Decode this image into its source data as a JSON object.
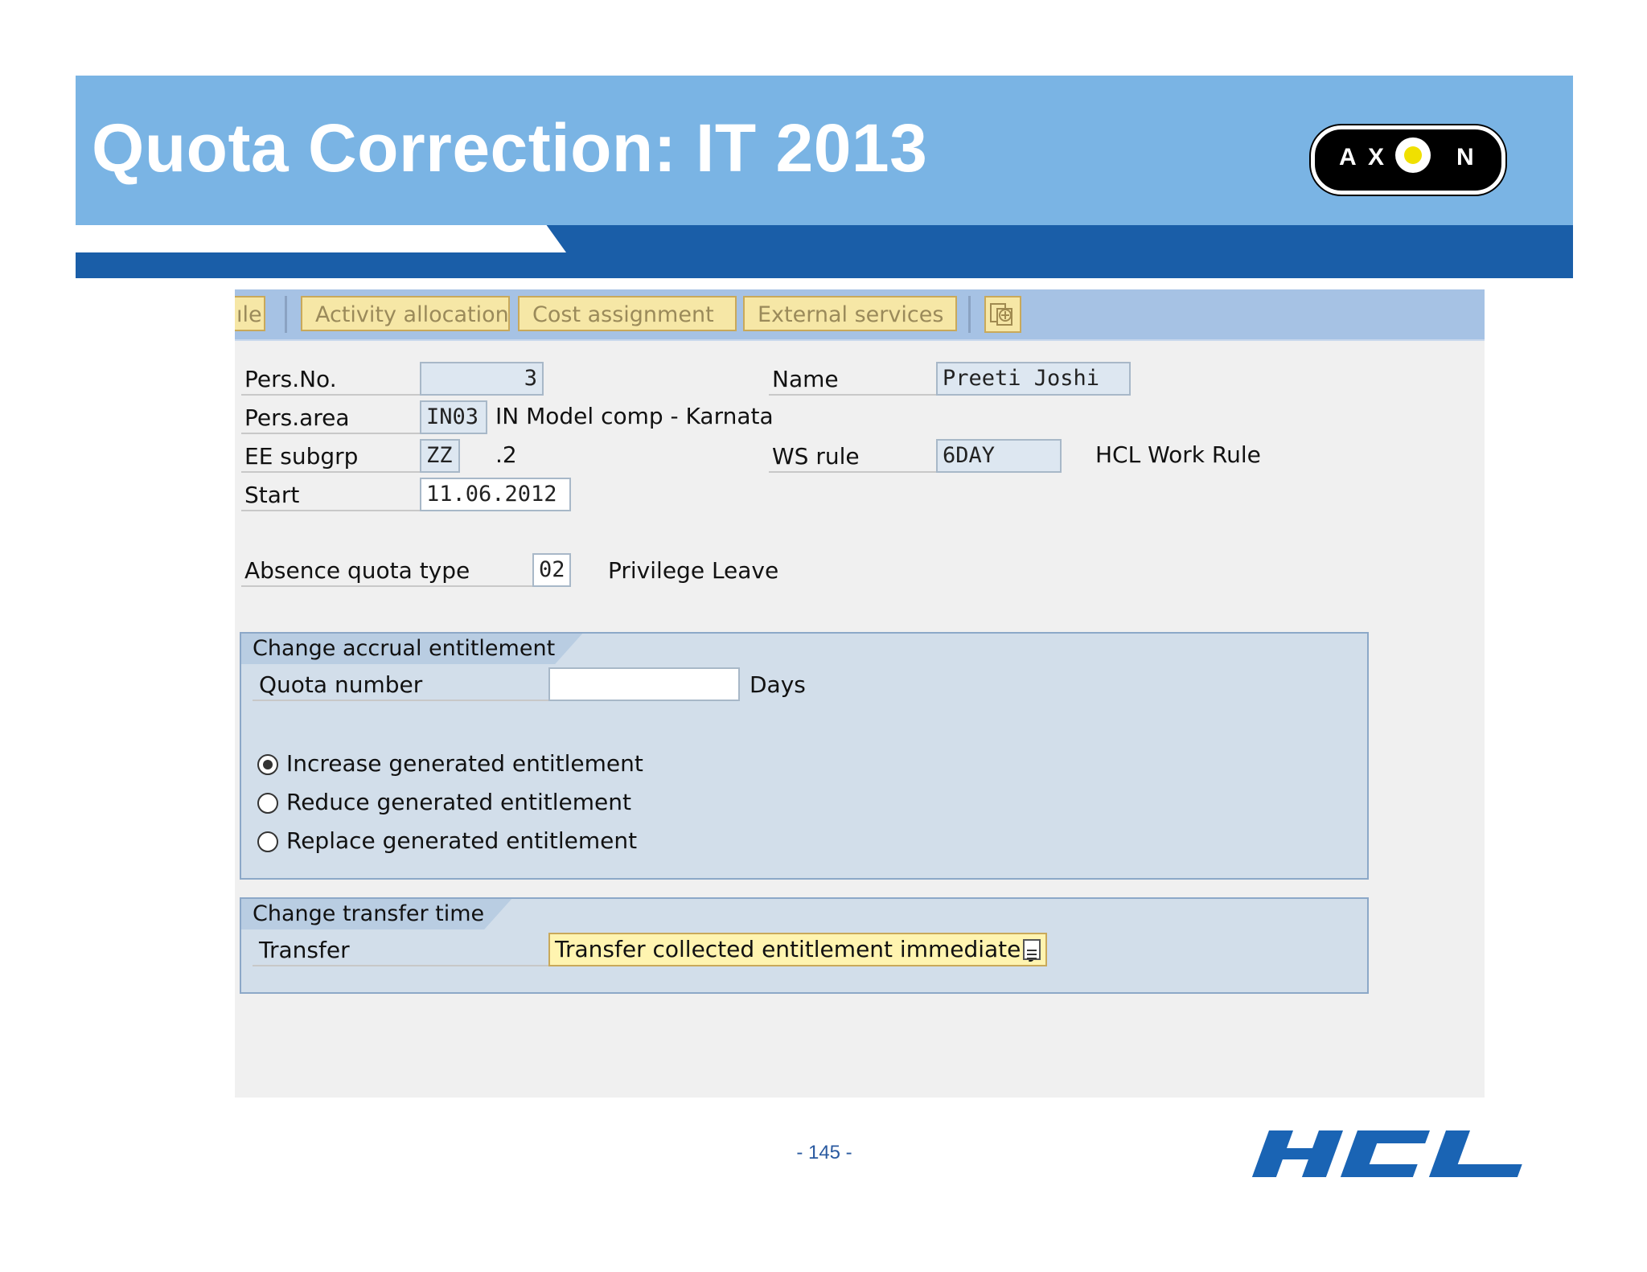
{
  "slide": {
    "title": "Quota Correction: IT 2013",
    "page_number": "- 145 -",
    "logo_axon": "AXON",
    "logo_hcl": "HCL"
  },
  "toolbar": {
    "cut_label": "ıle",
    "activity_allocation": "Activity allocation",
    "cost_assignment": "Cost assignment",
    "external_services": "External services",
    "extra_icon": "more-functions-icon"
  },
  "header_fields": {
    "pers_no_label": "Pers.No.",
    "pers_no_value": "3",
    "name_label": "Name",
    "name_value": "Preeti Joshi",
    "pers_area_label": "Pers.area",
    "pers_area_value": "IN03",
    "pers_area_text": "IN Model comp - Karnata",
    "ee_subgrp_label": "EE subgrp",
    "ee_subgrp_value": "ZZ",
    "ee_subgrp_text": ".2",
    "ws_rule_label": "WS rule",
    "ws_rule_value": "6DAY",
    "ws_rule_text": "HCL Work Rule",
    "start_label": "Start",
    "start_value": "11.06.2012"
  },
  "quota_type": {
    "label": "Absence quota type",
    "value": "02",
    "text": "Privilege Leave"
  },
  "accrual_group": {
    "title": "Change accrual entitlement",
    "quota_number_label": "Quota number",
    "quota_number_value": "",
    "unit": "Days",
    "options": [
      {
        "label": "Increase generated entitlement",
        "selected": true
      },
      {
        "label": "Reduce generated entitlement",
        "selected": false
      },
      {
        "label": "Replace generated entitlement",
        "selected": false
      }
    ]
  },
  "transfer_group": {
    "title": "Change transfer time",
    "transfer_label": "Transfer",
    "transfer_value": "Transfer collected entitlement immediately"
  },
  "colors": {
    "header_blue": "#7ab4e4",
    "band_blue": "#1a5ea8",
    "sap_toolbar": "#a6c2e4",
    "button_yellow": "#f6e7a6",
    "group_bg": "#d2deea",
    "hcl_blue": "#1a64b4"
  }
}
